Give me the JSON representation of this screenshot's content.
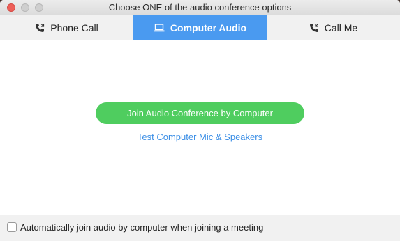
{
  "window": {
    "title": "Choose ONE of the audio conference options"
  },
  "tabs": [
    {
      "label": "Phone Call",
      "icon": "phone-icon",
      "selected": false
    },
    {
      "label": "Computer Audio",
      "icon": "laptop-icon",
      "selected": true
    },
    {
      "label": "Call Me",
      "icon": "phone-icon",
      "selected": false
    }
  ],
  "main": {
    "join_button": "Join Audio Conference by Computer",
    "test_link": "Test Computer Mic & Speakers"
  },
  "footer": {
    "auto_join_label": "Automatically join audio by computer when joining a meeting",
    "auto_join_checked": false
  },
  "colors": {
    "accent": "#4a9af0",
    "join_button": "#4fcd5f",
    "link": "#3c8fe6",
    "close": "#ee5f58"
  }
}
